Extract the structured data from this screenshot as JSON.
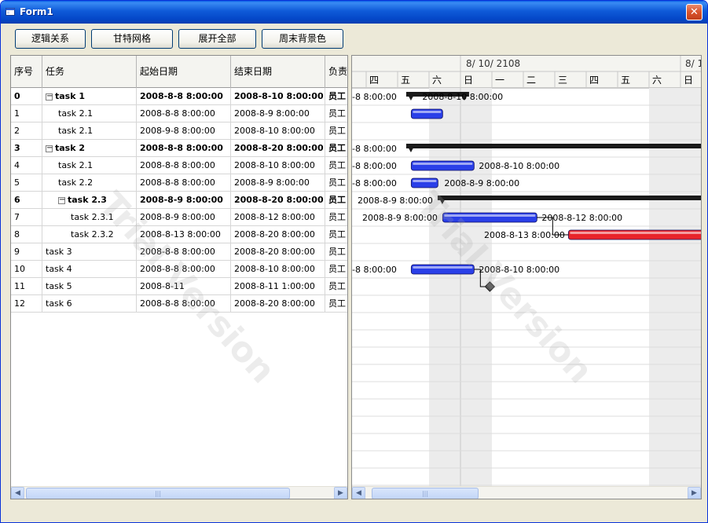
{
  "window": {
    "title": "Form1",
    "close_glyph": "✕",
    "icon": "form-icon"
  },
  "toolbar": {
    "logic_label": "逻辑关系",
    "gantt_grid_label": "甘特网格",
    "expand_all_label": "展开全部",
    "weekend_bg_label": "周末背景色"
  },
  "grid": {
    "columns": {
      "no": "序号",
      "task": "任务",
      "start": "起始日期",
      "end": "结束日期",
      "owner": "负责"
    },
    "rows": [
      {
        "no": "0",
        "task": "task 1",
        "start": "2008-8-8 8:00:00",
        "end": "2008-8-10 8:00:00",
        "owner": "员工",
        "bold": true,
        "level": 0,
        "expander": "−"
      },
      {
        "no": "1",
        "task": "task 2.1",
        "start": "2008-8-8 8:00:00",
        "end": "2008-8-9 8:00:00",
        "owner": "员工",
        "bold": false,
        "level": 1
      },
      {
        "no": "2",
        "task": "task 2.1",
        "start": "2008-9-8 8:00:00",
        "end": "2008-8-10 8:00:00",
        "owner": "员工",
        "bold": false,
        "level": 1
      },
      {
        "no": "3",
        "task": "task 2",
        "start": "2008-8-8 8:00:00",
        "end": "2008-8-20 8:00:00",
        "owner": "员工",
        "bold": true,
        "level": 0,
        "expander": "−"
      },
      {
        "no": "4",
        "task": "task 2.1",
        "start": "2008-8-8 8:00:00",
        "end": "2008-8-10 8:00:00",
        "owner": "员工",
        "bold": false,
        "level": 1
      },
      {
        "no": "5",
        "task": "task 2.2",
        "start": "2008-8-8 8:00:00",
        "end": "2008-8-9 8:00:00",
        "owner": "员工",
        "bold": false,
        "level": 1
      },
      {
        "no": "6",
        "task": "task 2.3",
        "start": "2008-8-9 8:00:00",
        "end": "2008-8-20 8:00:00",
        "owner": "员工",
        "bold": true,
        "level": 1,
        "expander": "−"
      },
      {
        "no": "7",
        "task": "task 2.3.1",
        "start": "2008-8-9 8:00:00",
        "end": "2008-8-12 8:00:00",
        "owner": "员工",
        "bold": false,
        "level": 2
      },
      {
        "no": "8",
        "task": "task 2.3.2",
        "start": "2008-8-13 8:00:00",
        "end": "2008-8-20 8:00:00",
        "owner": "员工",
        "bold": false,
        "level": 2
      },
      {
        "no": "9",
        "task": "task 3",
        "start": "2008-8-8 8:00:00",
        "end": "2008-8-20 8:00:00",
        "owner": "员工",
        "bold": false,
        "level": 0
      },
      {
        "no": "10",
        "task": "task 4",
        "start": "2008-8-8 8:00:00",
        "end": "2008-8-10 8:00:00",
        "owner": "员工",
        "bold": false,
        "level": 0
      },
      {
        "no": "11",
        "task": "task 5",
        "start": "2008-8-11",
        "end": "2008-8-11 1:00:00",
        "owner": "员工",
        "bold": false,
        "level": 0
      },
      {
        "no": "12",
        "task": "task 6",
        "start": "2008-8-8 8:00:00",
        "end": "2008-8-20 8:00:00",
        "owner": "员工",
        "bold": false,
        "level": 0
      }
    ]
  },
  "scroll": {
    "left_glyph": "◀",
    "right_glyph": "▶",
    "thumb_grip": "|||"
  },
  "gantt": {
    "week_label": "8/ 10/ 2108",
    "week_label_2": "8/ 1",
    "days": [
      "四",
      "五",
      "六",
      "日",
      "一",
      "二",
      "三",
      "四",
      "五",
      "六",
      "日"
    ],
    "weekend_days": [
      "六",
      "日"
    ],
    "colors": {
      "summary": "#1a1a1a",
      "normal": "#2a3fe8",
      "critical": "#e8242a",
      "weekend": "#ececec"
    },
    "bar_labels": [
      {
        "row": 0,
        "left": "-8 8:00:00",
        "right": "2008-8-10 8:00:00"
      },
      {
        "row": 3,
        "left": "-8 8:00:00",
        "right": ""
      },
      {
        "row": 4,
        "left": "-8 8:00:00",
        "right": "2008-8-10 8:00:00"
      },
      {
        "row": 5,
        "left": "-8 8:00:00",
        "right": "2008-8-9 8:00:00"
      },
      {
        "row": 6,
        "left": "2008-8-9 8:00:00",
        "right": ""
      },
      {
        "row": 7,
        "left": "2008-8-9 8:00:00",
        "right": "2008-8-12 8:00:00"
      },
      {
        "row": 8,
        "left": "2008-8-13 8:00:00",
        "right": ""
      },
      {
        "row": 10,
        "left": "-8 8:00:00",
        "right": "2008-8-10 8:00:00"
      }
    ],
    "watermark": "Trial Version"
  }
}
